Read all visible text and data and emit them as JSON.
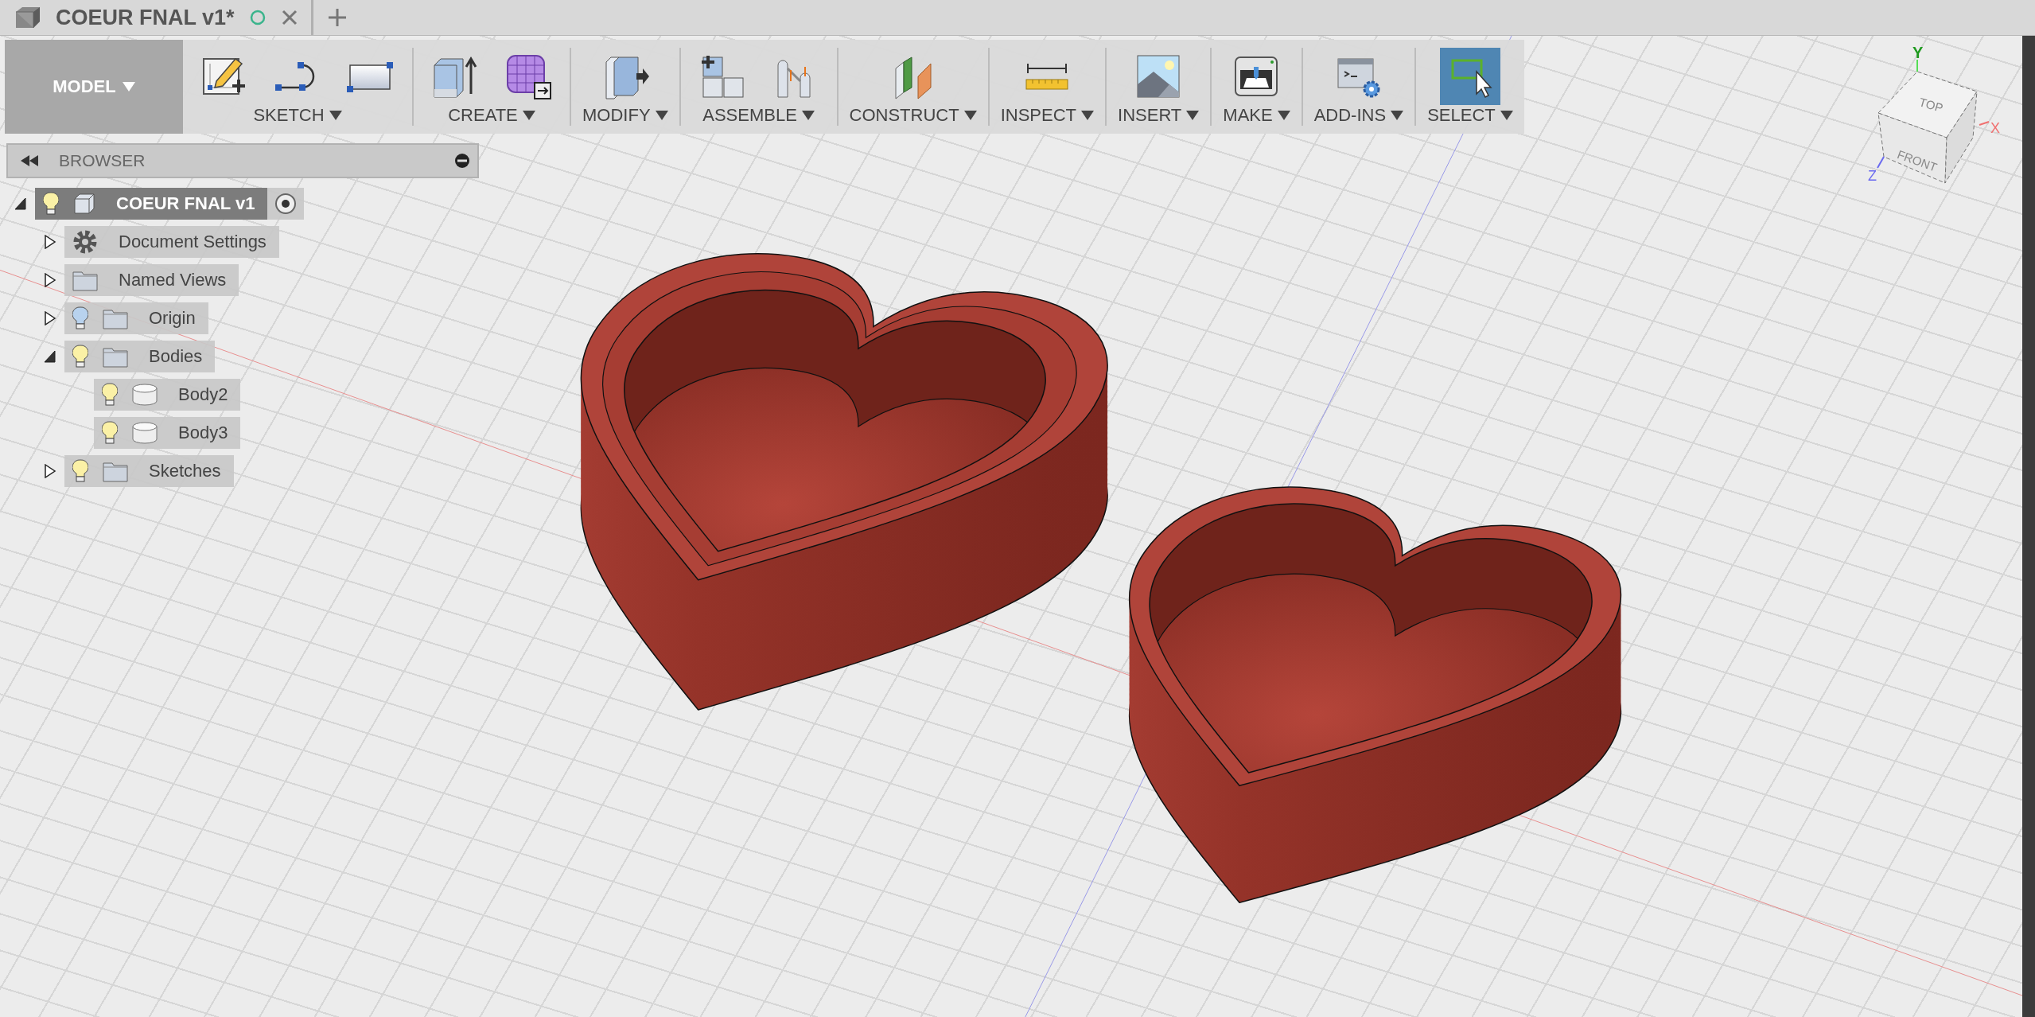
{
  "tab": {
    "title": "COEUR FNAL v1*"
  },
  "toolbar": {
    "workspace": "MODEL",
    "groups": [
      {
        "label": "SKETCH",
        "tools": [
          {
            "kind": "sketch",
            "selected": false
          },
          {
            "kind": "arc",
            "selected": false
          },
          {
            "kind": "rectangle",
            "selected": false
          }
        ]
      },
      {
        "label": "CREATE",
        "tools": [
          {
            "kind": "extrude",
            "selected": false
          },
          {
            "kind": "form",
            "selected": false
          }
        ]
      },
      {
        "label": "MODIFY",
        "tools": [
          {
            "kind": "presspull",
            "selected": false
          }
        ]
      },
      {
        "label": "ASSEMBLE",
        "tools": [
          {
            "kind": "component",
            "selected": false
          },
          {
            "kind": "joint",
            "selected": false
          }
        ]
      },
      {
        "label": "CONSTRUCT",
        "tools": [
          {
            "kind": "plane",
            "selected": false
          }
        ]
      },
      {
        "label": "INSPECT",
        "tools": [
          {
            "kind": "measure",
            "selected": false
          }
        ]
      },
      {
        "label": "INSERT",
        "tools": [
          {
            "kind": "image",
            "selected": false
          }
        ]
      },
      {
        "label": "MAKE",
        "tools": [
          {
            "kind": "printer",
            "selected": false
          }
        ]
      },
      {
        "label": "ADD-INS",
        "tools": [
          {
            "kind": "scripts",
            "selected": false
          }
        ]
      },
      {
        "label": "SELECT",
        "tools": [
          {
            "kind": "select",
            "selected": true
          }
        ]
      }
    ]
  },
  "browser": {
    "title": "BROWSER",
    "tree": [
      {
        "label": "COEUR FNAL v1",
        "kind": "component",
        "expanded": true,
        "selected": true,
        "visible": true,
        "active": true,
        "children": [
          {
            "label": "Document Settings",
            "kind": "settings",
            "expanded": false,
            "selected": false
          },
          {
            "label": "Named Views",
            "kind": "folder",
            "expanded": false,
            "selected": false
          },
          {
            "label": "Origin",
            "kind": "folder",
            "expanded": false,
            "selected": false,
            "visible": false
          },
          {
            "label": "Bodies",
            "kind": "folder",
            "expanded": true,
            "selected": false,
            "visible": true,
            "children": [
              {
                "label": "Body2",
                "kind": "body",
                "selected": false,
                "visible": true
              },
              {
                "label": "Body3",
                "kind": "body",
                "selected": false,
                "visible": true
              }
            ]
          },
          {
            "label": "Sketches",
            "kind": "folder",
            "expanded": false,
            "selected": false,
            "visible": true
          }
        ]
      }
    ]
  },
  "viewcube": {
    "top_face": "TOP",
    "front_face": "FRONT",
    "x_axis": "X",
    "y_axis": "Y",
    "z_axis": "Z"
  }
}
